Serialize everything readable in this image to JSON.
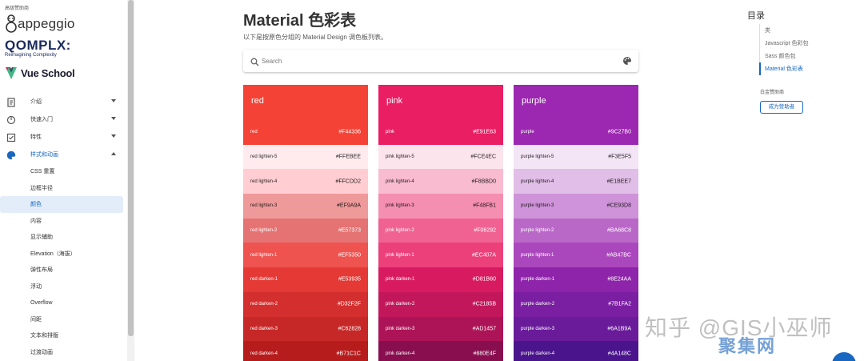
{
  "sidebar": {
    "sponsor_caption": "高级赞助商",
    "logos": {
      "appeggio": "appeggio",
      "qomplx": "QOMPLX:",
      "qomplx_tagline": "Reimagining Complexity",
      "vueschool": "Vue School"
    },
    "groups": [
      {
        "label": "介绍",
        "icon": "document-icon",
        "expanded": false
      },
      {
        "label": "快速入门",
        "icon": "speed-icon",
        "expanded": false
      },
      {
        "label": "特性",
        "icon": "checklist-icon",
        "expanded": false
      },
      {
        "label": "样式和动画",
        "icon": "palette-icon",
        "expanded": true
      }
    ],
    "sub_items": [
      "CSS 重置",
      "边框半径",
      "颜色",
      "内容",
      "显示辅助",
      "Elevation（海拔）",
      "弹性布局",
      "浮动",
      "Overflow",
      "间距",
      "文本和排版",
      "过渡动画"
    ],
    "active_sub": "颜色"
  },
  "main": {
    "title": "Material 色彩表",
    "subtitle": "以下是按原色分组的 Material Design 调色板列表。",
    "search": {
      "placeholder": "Search",
      "value": ""
    }
  },
  "palettes": [
    {
      "name": "red",
      "head_color": "#F44336",
      "rows": [
        {
          "name": "red",
          "hex": "#F44336"
        },
        {
          "name": "red lighten-5",
          "hex": "#FFEBEE"
        },
        {
          "name": "red lighten-4",
          "hex": "#FFCDD2"
        },
        {
          "name": "red lighten-3",
          "hex": "#EF9A9A"
        },
        {
          "name": "red lighten-2",
          "hex": "#E57373"
        },
        {
          "name": "red lighten-1",
          "hex": "#EF5350"
        },
        {
          "name": "red darken-1",
          "hex": "#E53935"
        },
        {
          "name": "red darken-2",
          "hex": "#D32F2F"
        },
        {
          "name": "red darken-3",
          "hex": "#C62828"
        },
        {
          "name": "red darken-4",
          "hex": "#B71C1C"
        }
      ]
    },
    {
      "name": "pink",
      "head_color": "#E91E63",
      "rows": [
        {
          "name": "pink",
          "hex": "#E91E63"
        },
        {
          "name": "pink lighten-5",
          "hex": "#FCE4EC"
        },
        {
          "name": "pink lighten-4",
          "hex": "#F8BBD0"
        },
        {
          "name": "pink lighten-3",
          "hex": "#F48FB1"
        },
        {
          "name": "pink lighten-2",
          "hex": "#F06292"
        },
        {
          "name": "pink lighten-1",
          "hex": "#EC407A"
        },
        {
          "name": "pink darken-1",
          "hex": "#D81B60"
        },
        {
          "name": "pink darken-2",
          "hex": "#C2185B"
        },
        {
          "name": "pink darken-3",
          "hex": "#AD1457"
        },
        {
          "name": "pink darken-4",
          "hex": "#880E4F"
        }
      ]
    },
    {
      "name": "purple",
      "head_color": "#9C27B0",
      "rows": [
        {
          "name": "purple",
          "hex": "#9C27B0"
        },
        {
          "name": "purple lighten-5",
          "hex": "#F3E5F5"
        },
        {
          "name": "purple lighten-4",
          "hex": "#E1BEE7"
        },
        {
          "name": "purple lighten-3",
          "hex": "#CE93D8"
        },
        {
          "name": "purple lighten-2",
          "hex": "#BA68C8"
        },
        {
          "name": "purple lighten-1",
          "hex": "#AB47BC"
        },
        {
          "name": "purple darken-1",
          "hex": "#8E24AA"
        },
        {
          "name": "purple darken-2",
          "hex": "#7B1FA2"
        },
        {
          "name": "purple darken-3",
          "hex": "#6A1B9A"
        },
        {
          "name": "purple darken-4",
          "hex": "#4A148C"
        }
      ]
    }
  ],
  "toc": {
    "title": "目录",
    "items": [
      "类",
      "Javascript 色彩包",
      "Sass 颜色包",
      "Material 色彩表"
    ],
    "active_item": "Material 色彩表",
    "gold_caption": "白金赞助商",
    "sponsor_button": "成为赞助者"
  },
  "watermark": {
    "line1": "知乎 @GIS小巫师",
    "line2": "聚集网"
  },
  "colors": {
    "accent": "#1867c0"
  }
}
